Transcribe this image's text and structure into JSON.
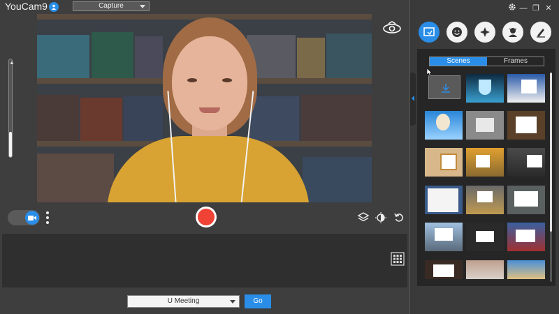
{
  "app": {
    "title": "YouCam9",
    "badge_icon": "person-icon"
  },
  "capture_mode": {
    "selected": "Capture"
  },
  "meeting": {
    "selected": "U Meeting",
    "go_label": "Go"
  },
  "side_panel": {
    "tabs": [
      {
        "icon": "scenes-icon",
        "active": true
      },
      {
        "icon": "emoji-icon",
        "active": false
      },
      {
        "icon": "effects-icon",
        "active": false
      },
      {
        "icon": "avatar-icon",
        "active": false
      },
      {
        "icon": "brush-icon",
        "active": false
      }
    ],
    "subtabs": {
      "active": "Scenes",
      "inactive": "Frames"
    }
  },
  "colors": {
    "accent": "#2a8ee8",
    "record": "#f04336",
    "sweater": "#d8a332"
  }
}
